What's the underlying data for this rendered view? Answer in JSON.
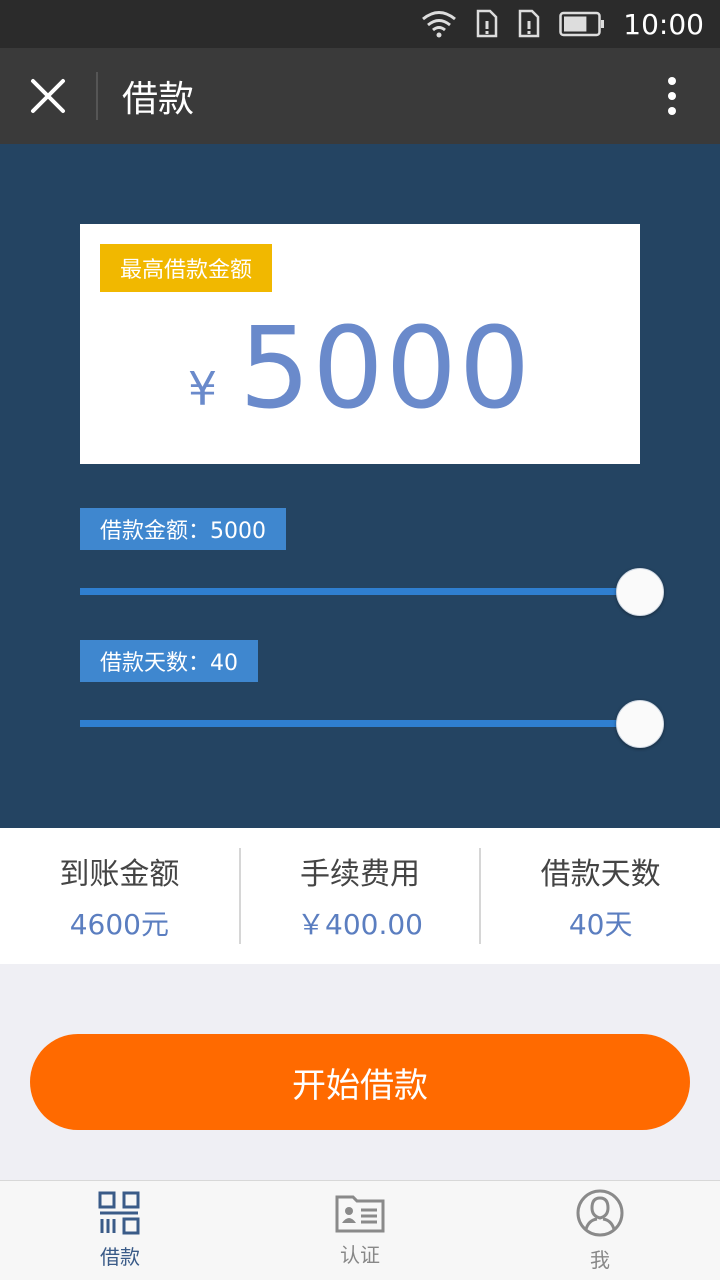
{
  "status_bar": {
    "time": "10:00",
    "battery_fraction": 0.7
  },
  "app_bar": {
    "title": "借款"
  },
  "hero": {
    "max_label": "最高借款金额",
    "currency": "¥",
    "max_amount": "5000",
    "amount_slider": {
      "label": "借款金额：5000",
      "fraction": 1.0
    },
    "days_slider": {
      "label": "借款天数：40",
      "fraction": 1.0
    }
  },
  "summary": [
    {
      "label": "到账金额",
      "value": "4600元"
    },
    {
      "label": "手续费用",
      "value": "￥400.00"
    },
    {
      "label": "借款天数",
      "value": "40天"
    }
  ],
  "start_button": {
    "label": "开始借款"
  },
  "bottom_nav": [
    {
      "label": "借款",
      "icon": "qr-loan-icon",
      "active": true
    },
    {
      "label": "认证",
      "icon": "id-card-icon",
      "active": false
    },
    {
      "label": "我",
      "icon": "user-icon",
      "active": false
    }
  ],
  "colors": {
    "hero_bg": "#244462",
    "accent_blue": "#3f87cf",
    "amount_blue": "#6a8acb",
    "tag_yellow": "#f1b800",
    "button_orange": "#ff6a00"
  }
}
